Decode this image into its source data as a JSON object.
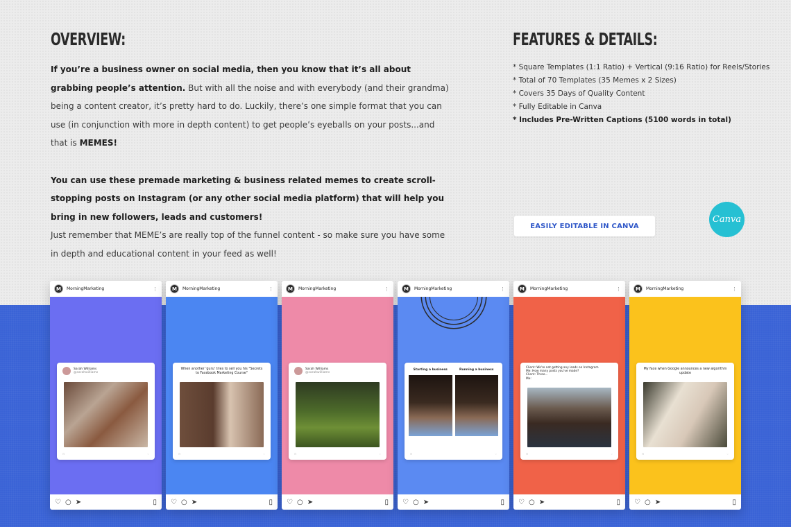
{
  "colors": {
    "accent": "#3a63d6",
    "card1": "#6b6ef2",
    "card2": "#4b86f2",
    "card3": "#ee8aa8",
    "card4": "#5b8af2",
    "card5": "#f06248",
    "card6": "#fbc21c",
    "canva": "#26c0d3"
  },
  "overview": {
    "title": "OVERVIEW:",
    "para1_bold": "If you’re a business owner on social media, then you know that it’s all about grabbing people’s attention.",
    "para1_rest": " But with all the noise and with everybody (and their grandma) being a content creator, it’s pretty hard to do. Luckily, there’s one simple format that you can use (in conjunction with more in depth content) to get people’s eyeballs on your posts...and that is ",
    "para1_end_bold": "MEMES!",
    "para2_bold": "You can use these premade marketing & business related memes to create scroll-stopping posts on Instagram (or any other social media platform) that will help you bring in new followers, leads and customers!",
    "para3": "Just remember that MEME’s are really top of the funnel content - so make sure you have some  in depth and educational content in your feed as well!"
  },
  "features": {
    "title": "FEATURES & DETAILS:",
    "items": [
      "* Square Templates (1:1 Ratio) + Vertical (9:16 Ratio) for Reels/Stories",
      "* Total of 70 Templates (35 Memes x 2 Sizes)",
      "* Covers 35 Days of Quality Content",
      "* Fully Editable in Canva",
      "* Includes Pre-Written Captions (5100 words in total)"
    ]
  },
  "canva_button": "EASILY EDITABLE IN CANVA",
  "canva_logo": "Canva",
  "phones": {
    "username": "MorningMarketing",
    "avatar_letter": "M",
    "cards": [
      {
        "post_name": "Sarah Williams",
        "post_handle": "@sarahwilliams"
      },
      {
        "caption": "When another 'guru' tries to sell you his \"Secrets to Facebook Marketing Course\""
      },
      {
        "post_name": "Sarah Williams",
        "post_handle": "@sarahwilliams"
      },
      {
        "left_label": "Starting a business",
        "right_label": "Running a business"
      },
      {
        "caption": "Client: We're not getting any leads on Instagram\nMe: How many posts you've made?\nClient: Three...\nMe:"
      },
      {
        "caption": "My face when Google announces a new algorithm update"
      }
    ]
  }
}
